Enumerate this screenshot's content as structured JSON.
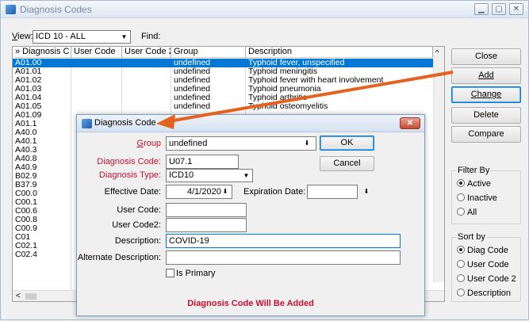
{
  "window": {
    "title": "Diagnosis Codes"
  },
  "toolbar": {
    "view_label": "View:",
    "view_value": "ICD 10 - ALL",
    "find_label": "Find:"
  },
  "grid": {
    "columns": [
      "» Diagnosis C",
      "User Code",
      "User Code 2",
      "Group",
      "Description"
    ],
    "rows": [
      {
        "code": "A01.00",
        "group": "undefined",
        "desc": "Typhoid fever, unspecified",
        "selected": true
      },
      {
        "code": "A01.01",
        "group": "undefined",
        "desc": "Typhoid meningitis"
      },
      {
        "code": "A01.02",
        "group": "undefined",
        "desc": "Typhoid fever with heart involvement"
      },
      {
        "code": "A01.03",
        "group": "undefined",
        "desc": "Typhoid pneumonia"
      },
      {
        "code": "A01.04",
        "group": "undefined",
        "desc": "Typhoid arthritis"
      },
      {
        "code": "A01.05",
        "group": "undefined",
        "desc": "Typhoid osteomyelitis"
      },
      {
        "code": "A01.09",
        "group": "",
        "desc": ""
      },
      {
        "code": "A01.1",
        "group": "",
        "desc": ""
      },
      {
        "code": "A40.0",
        "group": "",
        "desc": ""
      },
      {
        "code": "A40.1",
        "group": "",
        "desc": ""
      },
      {
        "code": "A40.3",
        "group": "",
        "desc": ""
      },
      {
        "code": "A40.8",
        "group": "",
        "desc": ""
      },
      {
        "code": "A40.9",
        "group": "",
        "desc": ""
      },
      {
        "code": "B02.9",
        "group": "",
        "desc": ""
      },
      {
        "code": "B37.9",
        "group": "",
        "desc": ""
      },
      {
        "code": "C00.0",
        "group": "",
        "desc": ""
      },
      {
        "code": "C00.1",
        "group": "",
        "desc": ""
      },
      {
        "code": "C00.6",
        "group": "",
        "desc": ""
      },
      {
        "code": "C00.8",
        "group": "",
        "desc": ""
      },
      {
        "code": "C00.9",
        "group": "",
        "desc": ""
      },
      {
        "code": "C01",
        "group": "",
        "desc": ""
      },
      {
        "code": "C02.1",
        "group": "",
        "desc": ""
      },
      {
        "code": "C02.4",
        "group": "",
        "desc": ""
      }
    ]
  },
  "buttons": {
    "close": "Close",
    "add": "Add",
    "change": "Change",
    "delete": "Delete",
    "compare": "Compare"
  },
  "filter": {
    "title": "Filter By",
    "active": "Active",
    "inactive": "Inactive",
    "all": "All",
    "selected": "Active"
  },
  "sort": {
    "title": "Sort by",
    "diag": "Diag Code",
    "user": "User Code",
    "user2": "User Code 2",
    "desc": "Description",
    "selected": "Diag Code"
  },
  "dialog": {
    "title": "Diagnosis Code",
    "group_label": "Group",
    "group_value": "undefined",
    "code_label": "Diagnosis Code:",
    "code_value": "U07.1",
    "type_label": "Diagnosis Type:",
    "type_value": "ICD10",
    "eff_label": "Effective Date:",
    "eff_value": "4/1/2020",
    "exp_label": "Expiration Date:",
    "exp_value": "",
    "user_code_label": "User Code:",
    "user_code2_label": "User Code2:",
    "desc_label": "Description:",
    "desc_value": "COVID-19",
    "alt_desc_label": "Alternate Description:",
    "primary_label": "Is Primary",
    "ok": "OK",
    "cancel": "Cancel",
    "status": "Diagnosis Code Will Be Added",
    "close_glyph": "✕"
  },
  "colors": {
    "selection": "#0078d7",
    "required_label": "#c8102e",
    "arrow": "#e2621e"
  }
}
